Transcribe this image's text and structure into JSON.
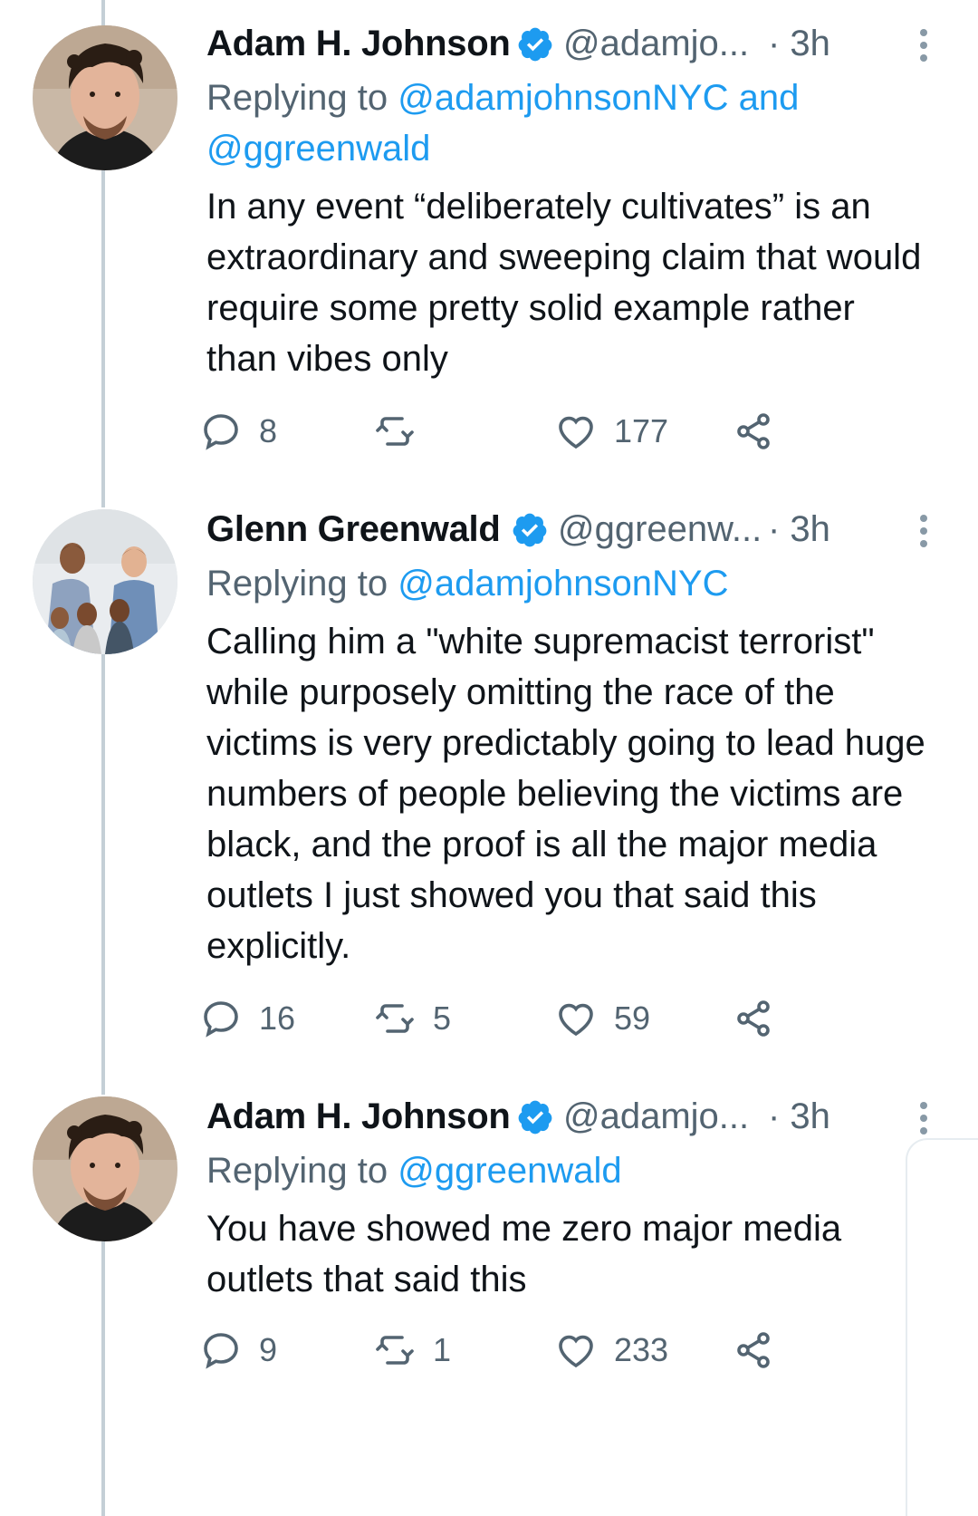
{
  "tweets": [
    {
      "name": "Adam H. Johnson",
      "handle": "@adamjo...",
      "time": "· 3h",
      "reply_prefix": "Replying to ",
      "reply_mentions": "@adamjohnsonNYC and @ggreenwald",
      "text": "In any event “deliberately cultivates” is an extraordinary and sweeping claim that would require some pretty solid example rather than vibes only",
      "replies": "8",
      "retweets": "",
      "likes": "177"
    },
    {
      "name": "Glenn Greenwald",
      "handle": "@ggreenw...",
      "time": "· 3h",
      "reply_prefix": "Replying to ",
      "reply_mentions": "@adamjohnsonNYC",
      "text": "Calling him a \"white supremacist terrorist\" while purposely omitting the race of the victims is very predictably going to lead huge numbers of people believing the victims are black, and the proof is all the major media outlets I just showed you that said this explicitly.",
      "replies": "16",
      "retweets": "5",
      "likes": "59"
    },
    {
      "name": "Adam H. Johnson",
      "handle": "@adamjo...",
      "time": "· 3h",
      "reply_prefix": "Replying to ",
      "reply_mentions": "@ggreenwald",
      "text": "You have showed me zero major media outlets that said this",
      "replies": "9",
      "retweets": "1",
      "likes": "233"
    }
  ],
  "icons": {
    "reply": "reply-icon",
    "retweet": "retweet-icon",
    "like": "heart-icon",
    "share": "share-icon",
    "verified": "verified-badge-icon",
    "more": "more-vertical-icon"
  },
  "colors": {
    "accent": "#1d9bf0",
    "secondary_text": "#536471",
    "primary_text": "#0f1419",
    "thread_line": "#c4cfd6"
  }
}
